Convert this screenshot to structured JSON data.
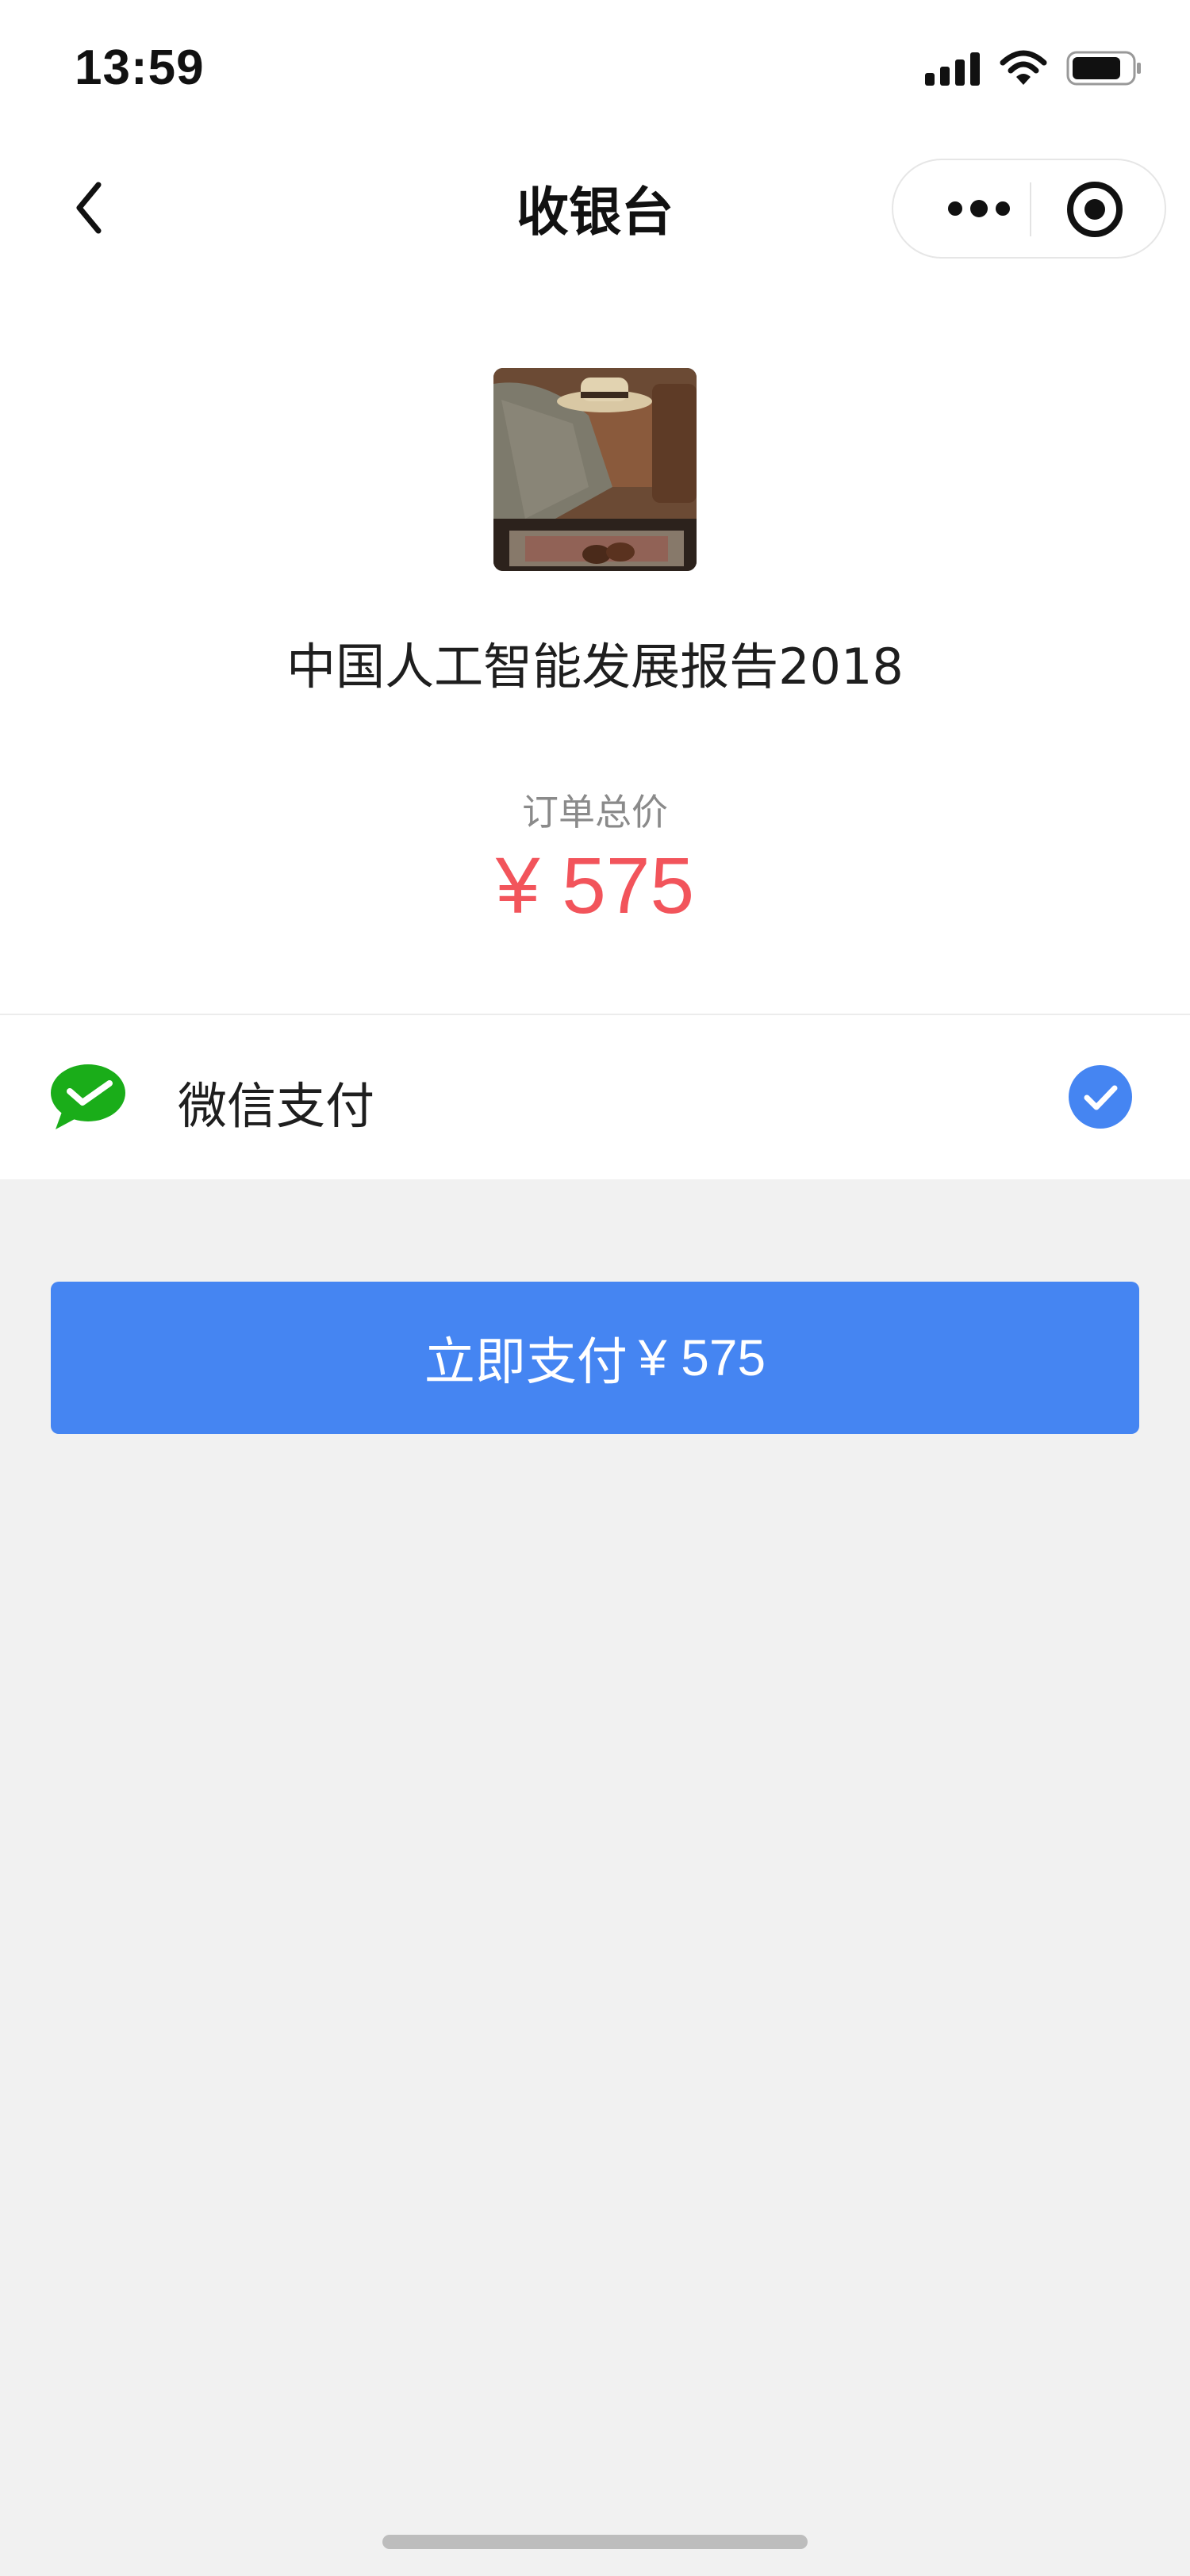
{
  "status_bar": {
    "time": "13:59",
    "icons": [
      "signal-icon",
      "wifi-icon",
      "battery-icon"
    ]
  },
  "nav": {
    "title": "收银台",
    "back_icon": "chevron-left-icon",
    "capsule_icons": [
      "more-icon",
      "close-target-icon"
    ]
  },
  "product": {
    "image": "product-photo",
    "title": "中国人工智能发展报告2018"
  },
  "order": {
    "total_label": "订单总价",
    "currency": "¥",
    "amount": "575",
    "price_display": "¥ 575"
  },
  "payment": {
    "method_label": "微信支付",
    "method_icon": "wechat-pay-icon",
    "selected": true
  },
  "pay_button": {
    "label": "立即支付",
    "amount": "¥ 575"
  },
  "colors": {
    "price": "#f2545b",
    "button": "#4585f2",
    "check": "#4585f2",
    "wechat": "#1aad19",
    "background": "#f1f1f1"
  }
}
